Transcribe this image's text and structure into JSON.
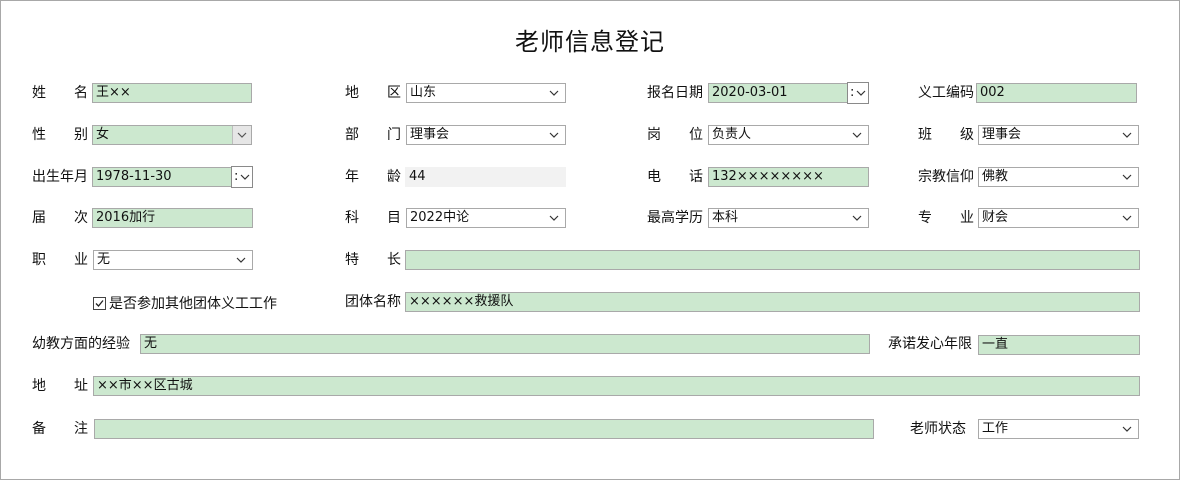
{
  "title": "老师信息登记",
  "labels": {
    "name": "姓名",
    "region": "地区",
    "signup_date": "报名日期",
    "volunteer_id": "义工编码",
    "gender": "性别",
    "department": "部门",
    "position": "岗位",
    "class": "班级",
    "birth_date": "出生年月",
    "age": "年龄",
    "phone": "电话",
    "religion": "宗教信仰",
    "session": "届次",
    "subject": "科目",
    "education": "最高学历",
    "major": "专业",
    "occupation": "职业",
    "specialty": "特长",
    "group_name": "团体名称",
    "experience": "幼教方面的经验",
    "commitment_years": "承诺发心年限",
    "address": "地址",
    "remarks": "备注",
    "teacher_status": "老师状态"
  },
  "values": {
    "name": "王××",
    "region": "山东",
    "signup_date": "2020-03-01",
    "volunteer_id": "002",
    "gender": "女",
    "department": "理事会",
    "position": "负责人",
    "class": "理事会",
    "birth_date": "1978-11-30",
    "age": "44",
    "phone": "132××××××××",
    "religion": "佛教",
    "session": "2016加行",
    "subject": "2022中论",
    "education": "本科",
    "major": "财会",
    "occupation": "无",
    "specialty": "",
    "group_name": "××××××救援队",
    "experience": "无",
    "commitment_years": "一直",
    "address": "××市××区古城",
    "remarks": "",
    "teacher_status": "工作"
  },
  "checkbox": {
    "label": "是否参加其他团体义工工作",
    "checked": true
  },
  "date_spin_glyph": ":",
  "icons": {
    "dropdown": "chevron-down-icon",
    "checkbox": "checkmark-icon"
  },
  "colors": {
    "field_fill": "#cce8cf",
    "border": "#a9a9a9"
  }
}
